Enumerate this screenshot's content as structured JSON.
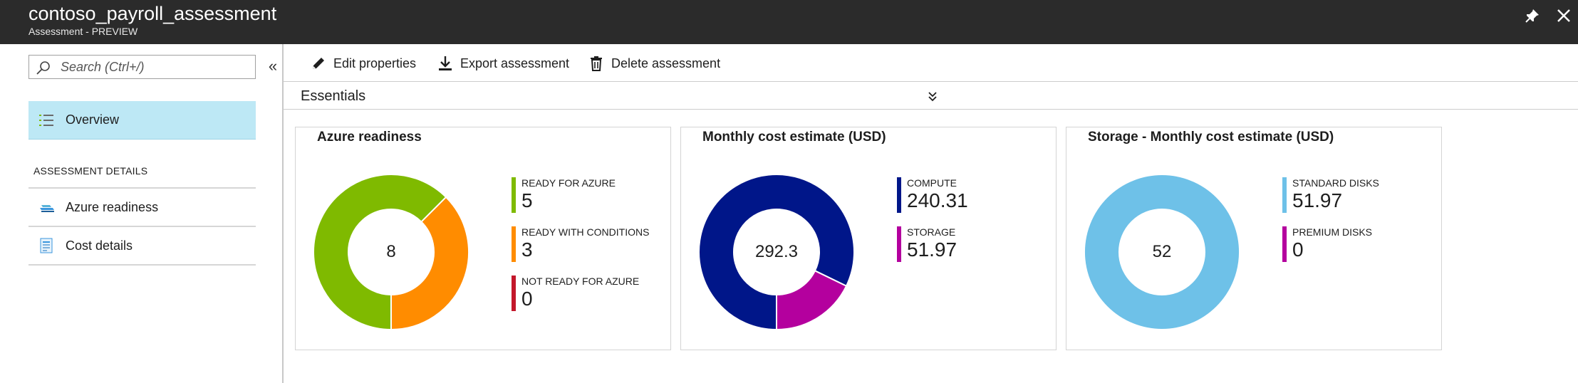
{
  "window": {
    "title": "contoso_payroll_assessment",
    "subtitle": "Assessment - PREVIEW"
  },
  "sidebar": {
    "search_placeholder": "Search (Ctrl+/)",
    "overview_label": "Overview",
    "section_header": "ASSESSMENT DETAILS",
    "items": [
      {
        "label": "Azure readiness",
        "icon": "azure-readiness-icon"
      },
      {
        "label": "Cost details",
        "icon": "cost-details-icon"
      }
    ]
  },
  "toolbar": {
    "edit_label": "Edit properties",
    "export_label": "Export assessment",
    "delete_label": "Delete assessment"
  },
  "essentials_label": "Essentials",
  "colors": {
    "ready": "#7fba00",
    "conditions": "#ff8c00",
    "not_ready": "#c3172b",
    "compute": "#001689",
    "storage": "#b4009e",
    "standard_disks": "#6ec1e8",
    "premium_disks": "#b4009e",
    "selected_nav": "#bde8f5"
  },
  "cards": [
    {
      "title": "Azure readiness",
      "center": "8",
      "legend": [
        {
          "name": "READY FOR AZURE",
          "value": "5"
        },
        {
          "name": "READY WITH CONDITIONS",
          "value": "3"
        },
        {
          "name": "NOT READY FOR AZURE",
          "value": "0"
        }
      ]
    },
    {
      "title": "Monthly cost estimate (USD)",
      "center": "292.3",
      "legend": [
        {
          "name": "COMPUTE",
          "value": "240.31"
        },
        {
          "name": "STORAGE",
          "value": "51.97"
        }
      ]
    },
    {
      "title": "Storage - Monthly cost estimate (USD)",
      "center": "52",
      "legend": [
        {
          "name": "STANDARD DISKS",
          "value": "51.97"
        },
        {
          "name": "PREMIUM DISKS",
          "value": "0"
        }
      ]
    }
  ],
  "chart_data": [
    {
      "type": "pie",
      "title": "Azure readiness",
      "categories": [
        "READY FOR AZURE",
        "READY WITH CONDITIONS",
        "NOT READY FOR AZURE"
      ],
      "values": [
        5,
        3,
        0
      ],
      "colors": [
        "#7fba00",
        "#ff8c00",
        "#c3172b"
      ],
      "center_label": "8"
    },
    {
      "type": "pie",
      "title": "Monthly cost estimate (USD)",
      "categories": [
        "COMPUTE",
        "STORAGE"
      ],
      "values": [
        240.31,
        51.97
      ],
      "colors": [
        "#001689",
        "#b4009e"
      ],
      "center_label": "292.3"
    },
    {
      "type": "pie",
      "title": "Storage - Monthly cost estimate (USD)",
      "categories": [
        "STANDARD DISKS",
        "PREMIUM DISKS"
      ],
      "values": [
        51.97,
        0
      ],
      "colors": [
        "#6ec1e8",
        "#b4009e"
      ],
      "center_label": "52"
    }
  ]
}
